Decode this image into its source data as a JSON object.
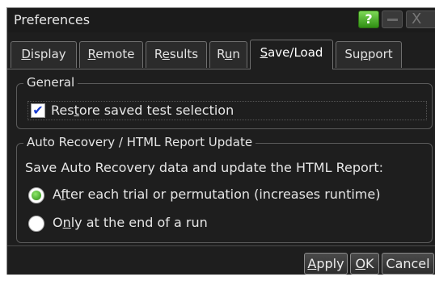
{
  "window": {
    "title": "Preferences",
    "help_glyph": "?",
    "close_glyph": "X"
  },
  "tabs": [
    {
      "pre": "",
      "key": "D",
      "post": "isplay",
      "active": false
    },
    {
      "pre": "",
      "key": "R",
      "post": "emote",
      "active": false
    },
    {
      "pre": "R",
      "key": "e",
      "post": "sults",
      "active": false
    },
    {
      "pre": "R",
      "key": "u",
      "post": "n",
      "active": false
    },
    {
      "pre": "",
      "key": "S",
      "post": "ave/Load",
      "active": true
    },
    {
      "pre": "Su",
      "key": "p",
      "post": "port",
      "active": false
    }
  ],
  "general": {
    "legend": "General",
    "restore": {
      "pre": "Res",
      "key": "t",
      "post": "ore saved test selection",
      "checked": true,
      "check_glyph": "✔"
    }
  },
  "recovery": {
    "legend": "Auto Recovery / HTML Report Update",
    "description": "Save Auto Recovery data and update the HTML Report:",
    "options": [
      {
        "pre": "A",
        "key": "f",
        "post": "ter each trial or permutation (increases runtime)",
        "selected": true
      },
      {
        "pre": "O",
        "key": "n",
        "post": "ly at the end of a run",
        "selected": false
      }
    ]
  },
  "buttons": {
    "apply": "Apply",
    "ok": "OK",
    "cancel": "Cancel"
  },
  "colors": {
    "background": "#1e1e1e",
    "accent_green": "#2f8f13",
    "check_blue": "#1a3ccf"
  }
}
